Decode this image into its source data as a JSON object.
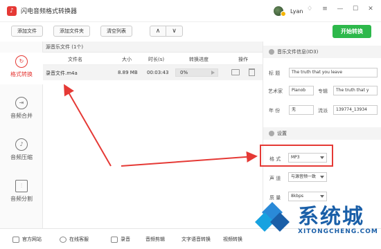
{
  "app": {
    "title": "闪电音频格式转换器",
    "user_name": "Lyan"
  },
  "window_buttons": [
    "♢",
    "≡",
    "—",
    "☐",
    "✕"
  ],
  "toolbar": {
    "add_file": "添加文件",
    "add_folder": "添加文件夹",
    "clear_list": "清空列表",
    "up": "∧",
    "down": "∨",
    "start": "开始转换"
  },
  "sidebar": [
    {
      "label": "格式转换",
      "icon": "refresh-icon",
      "active": true
    },
    {
      "label": "音频合并",
      "icon": "merge-icon",
      "active": false
    },
    {
      "label": "音频压缩",
      "icon": "compress-icon",
      "active": false
    },
    {
      "label": "音频分割",
      "icon": "split-icon",
      "active": false
    }
  ],
  "file_panel": {
    "title": "源音乐文件 (1个)",
    "columns": [
      "文件名",
      "大小",
      "时长(s)",
      "转换进度",
      "操作"
    ],
    "rows": [
      {
        "name": "录音文件.m4a",
        "size": "8.89 MB",
        "duration": "00:03:43",
        "progress": "0%"
      }
    ]
  },
  "id3": {
    "title": "音乐文件信息(ID3)",
    "title_label": "标   题",
    "title_value": "The truth that you leave",
    "artist_label": "艺术家",
    "artist_value": "Pianob",
    "album_label": "专辑",
    "album_value": "The truth that y",
    "year_label": "年   份",
    "year_value": "无",
    "genre_label": "流派",
    "genre_value": "139774_13934"
  },
  "settings": {
    "title": "设置",
    "format_label": "格   式",
    "format_value": "MP3",
    "channel_label": "声   道",
    "channel_value": "与源音频一致",
    "quality_label": "质   量",
    "quality_value": "8kbps"
  },
  "bottom_bar": {
    "website": "官方网站",
    "support": "在线客服",
    "record": "录音",
    "cut": "音频剪辑",
    "tts": "文字语音转换",
    "video": "视频转换"
  },
  "watermark": {
    "text": "系统城",
    "url": "XITONGCHENG.COM"
  },
  "colors": {
    "accent": "#e53935",
    "start": "#2db84b",
    "watermark": "#1a5fa8"
  }
}
